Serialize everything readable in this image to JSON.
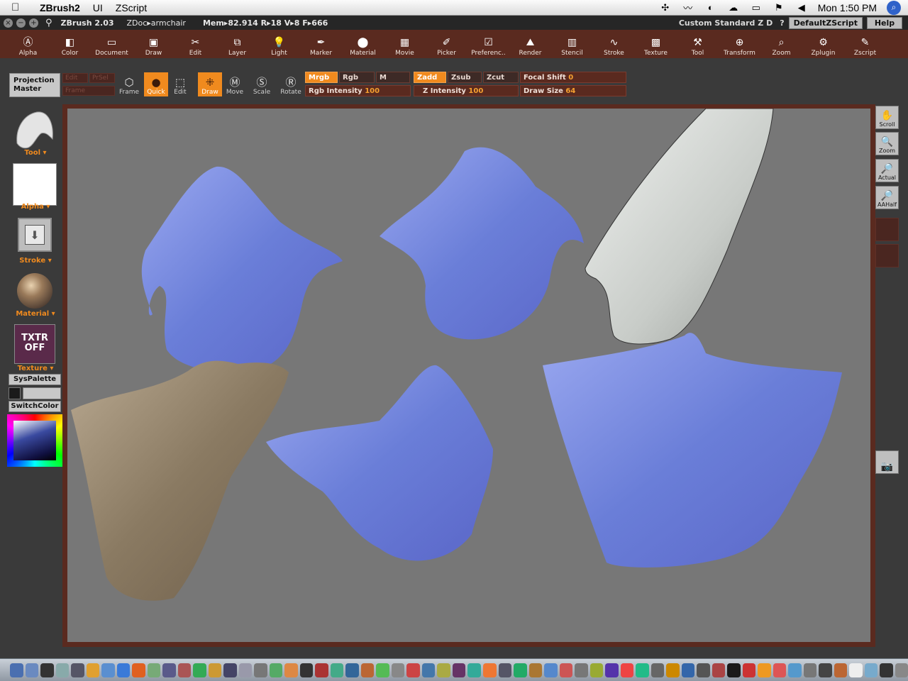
{
  "menubar": {
    "apple": "",
    "app": "ZBrush2",
    "menus": [
      "UI",
      "ZScript"
    ],
    "clock": "Mon 1:50 PM"
  },
  "titlebar": {
    "version": "ZBrush 2.03",
    "document": "ZDoc▸armchair",
    "stats": "Mem▸82.914  R▸18  V▸8  F▸666",
    "layout": "Custom  Standard  Z  D",
    "question": "?",
    "zscript_btn": "DefaultZScript",
    "help_btn": "Help"
  },
  "palettes": [
    "Alpha",
    "Color",
    "Document",
    "Draw",
    "Edit",
    "Layer",
    "Light",
    "Marker",
    "Material",
    "Movie",
    "Picker",
    "Preferenc..",
    "Render",
    "Stencil",
    "Stroke",
    "Texture",
    "Tool",
    "Transform",
    "Zoom",
    "Zplugin",
    "Zscript"
  ],
  "shelf": {
    "projection_master": "Projection Master",
    "ghost1": "Edit",
    "ghost2": "PrSel",
    "ghost3": "Frame",
    "frame": "Frame",
    "quick": "Quick",
    "edit": "Edit",
    "draw": "Draw",
    "move": "Move",
    "scale": "Scale",
    "rotate": "Rotate",
    "mrgb": "Mrgb",
    "rgb": "Rgb",
    "m": "M",
    "zadd": "Zadd",
    "zsub": "Zsub",
    "zcut": "Zcut",
    "focal_label": "Focal Shift",
    "focal_value": "0",
    "rgb_int_label": "Rgb Intensity",
    "rgb_int_value": "100",
    "z_int_label": "Z Intensity",
    "z_int_value": "100",
    "draw_size_label": "Draw Size",
    "draw_size_value": "64"
  },
  "lefttray": {
    "tool": "Tool",
    "alpha": "Alpha",
    "stroke": "Stroke",
    "material": "Material",
    "texture_icon": "TXTR OFF",
    "texture": "Texture",
    "syspalette": "SysPalette",
    "switchcolor": "SwitchColor"
  },
  "righttray": {
    "scroll": "Scroll",
    "zoom": "Zoom",
    "actual": "Actual",
    "aahalf": "AAHalf"
  },
  "colors": {
    "accent": "#f08a1e",
    "palette_bg": "#5a2a1f",
    "canvas_bg": "#777777",
    "cloth_blue": "#6f86d8",
    "cloth_tan": "#8a7a62",
    "cloth_gray": "#c8ccc8"
  }
}
